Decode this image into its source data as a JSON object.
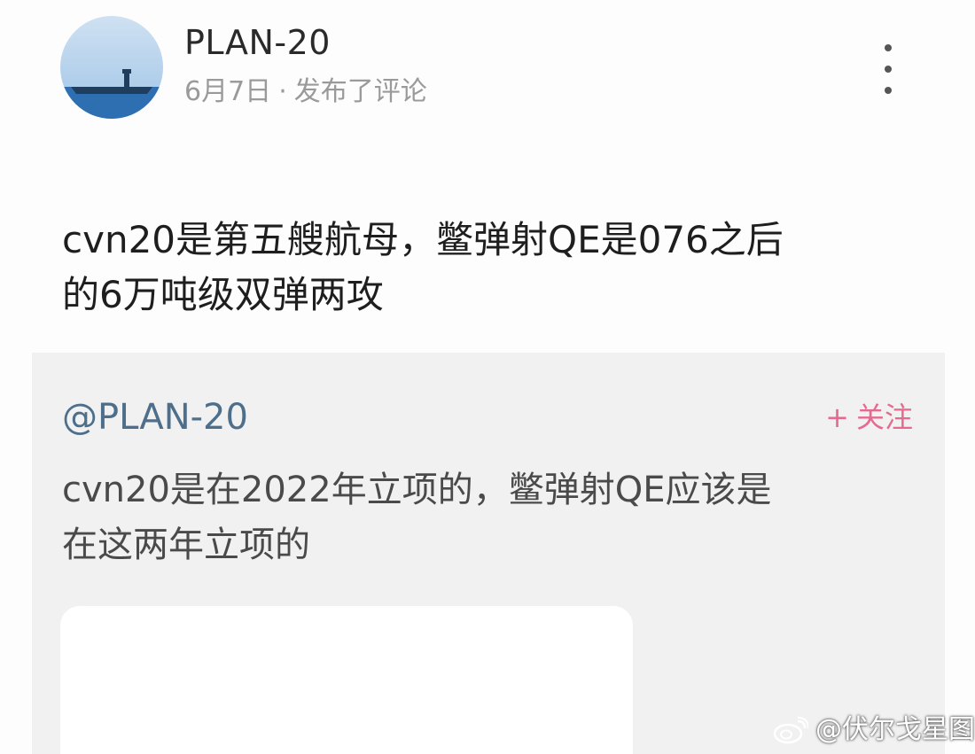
{
  "post": {
    "username": "PLAN-20",
    "date": "6月7日",
    "separator": "·",
    "action": "发布了评论",
    "body": "cvn20是第五艘航母，鳖弹射QE是076之后\n的6万吨级双弹两攻"
  },
  "quote": {
    "author": "@PLAN-20",
    "follow_label": "关注",
    "follow_prefix": "+",
    "body": "cvn20是在2022年立项的，鳖弹射QE应该是\n在这两年立项的"
  },
  "watermark": {
    "text": "@伏尔戈星图"
  },
  "icons": {
    "more": "more-vertical-icon",
    "weibo": "weibo-logo-icon"
  },
  "colors": {
    "quote_author": "#4d6f8b",
    "follow": "#e46b8f",
    "quote_background": "#f1f1f2"
  }
}
